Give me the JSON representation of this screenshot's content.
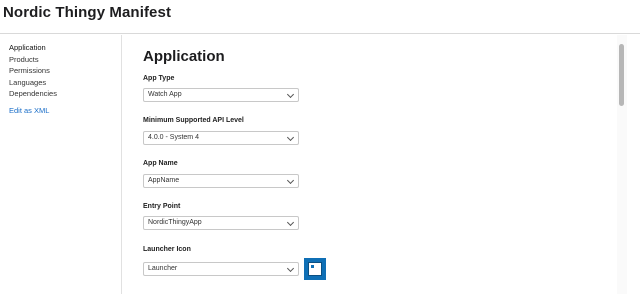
{
  "app": {
    "title": "Nordic Thingy Manifest"
  },
  "sidebar": {
    "items": [
      {
        "label": "Application"
      },
      {
        "label": "Products"
      },
      {
        "label": "Permissions"
      },
      {
        "label": "Languages"
      },
      {
        "label": "Dependencies"
      }
    ],
    "edit_link": "Edit as XML"
  },
  "main": {
    "title": "Application",
    "fields": [
      {
        "label": "App Type",
        "value": "Watch App"
      },
      {
        "label": "Minimum Supported API Level",
        "value": "4.0.0 - System 4"
      },
      {
        "label": "App Name",
        "value": "AppName"
      },
      {
        "label": "Entry Point",
        "value": "NordicThingyApp"
      },
      {
        "label": "Launcher Icon",
        "value": "Launcher"
      }
    ]
  },
  "icons": {
    "chevron": "chevron-down-icon",
    "launcher_preview": "launcher-icon-preview"
  },
  "colors": {
    "accent": "#0f6fb5",
    "link": "#1a6ec8"
  }
}
